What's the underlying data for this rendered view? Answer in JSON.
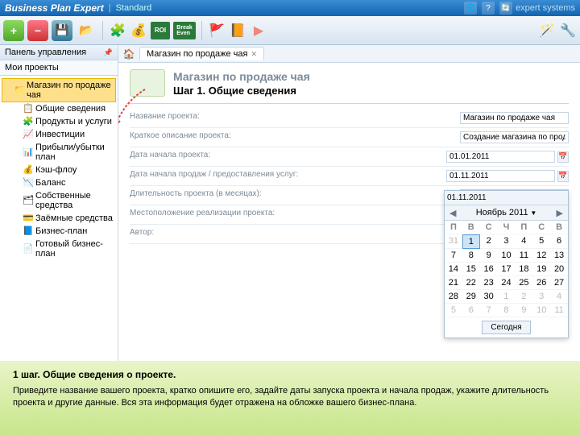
{
  "titlebar": {
    "app": "Business Plan Expert",
    "edition": "Standard",
    "brand": "expert systems"
  },
  "toolbar": {
    "items": [
      "add",
      "remove",
      "save",
      "open",
      "",
      "puzzle",
      "bag",
      "roi",
      "breakeven",
      "",
      "flag",
      "help",
      "play"
    ]
  },
  "sidebar": {
    "panel_title": "Панель управления",
    "section": "Мои проекты",
    "items": [
      {
        "icon": "📁",
        "label": "Магазин по продаже чая",
        "sel": true,
        "lvl": 1
      },
      {
        "icon": "📋",
        "label": "Общие сведения",
        "lvl": 2
      },
      {
        "icon": "🧩",
        "label": "Продукты и услуги",
        "lvl": 2
      },
      {
        "icon": "📈",
        "label": "Инвестиции",
        "lvl": 2
      },
      {
        "icon": "📊",
        "label": "Прибыли/убытки план",
        "lvl": 2
      },
      {
        "icon": "💰",
        "label": "Кэш-флоу",
        "lvl": 2
      },
      {
        "icon": "📉",
        "label": "Баланс",
        "lvl": 2
      },
      {
        "icon": "🗂",
        "label": "Собственные средства",
        "lvl": 2
      },
      {
        "icon": "💳",
        "label": "Заёмные средства",
        "lvl": 2
      },
      {
        "icon": "📘",
        "label": "Бизнес-план",
        "lvl": 2
      },
      {
        "icon": "📄",
        "label": "Готовый бизнес-план",
        "lvl": 2
      }
    ]
  },
  "tabs": {
    "active": "Магазин по продаже чая"
  },
  "page": {
    "title": "Магазин по продаже чая",
    "step": "Шаг 1. Общие сведения",
    "fields": [
      {
        "label": "Название проекта:",
        "value": "Магазин по продаже чая"
      },
      {
        "label": "Краткое описание проекта:",
        "value": "Создание магазина по продаже элитных сортов чая и кофе"
      },
      {
        "label": "Дата начала проекта:",
        "value": "01.01.2011",
        "date": true
      },
      {
        "label": "Дата начала продаж / предоставления услуг:",
        "value": "01.11.2011",
        "date": true,
        "open": true
      },
      {
        "label": "Длительность проекта (в месяцах):",
        "value": ""
      },
      {
        "label": "Местоположение реализации проекта:",
        "value": ""
      },
      {
        "label": "Автор:",
        "value": ""
      }
    ]
  },
  "calendar": {
    "selected": "01.11.2011",
    "month": "Ноябрь 2011",
    "dow": [
      "П",
      "В",
      "С",
      "Ч",
      "П",
      "С",
      "В"
    ],
    "grid": [
      [
        31,
        1,
        2,
        3,
        4,
        5,
        6
      ],
      [
        7,
        8,
        9,
        10,
        11,
        12,
        13
      ],
      [
        14,
        15,
        16,
        17,
        18,
        19,
        20
      ],
      [
        21,
        22,
        23,
        24,
        25,
        26,
        27
      ],
      [
        28,
        29,
        30,
        1,
        2,
        3,
        4
      ],
      [
        5,
        6,
        7,
        8,
        9,
        10,
        11
      ]
    ],
    "today_btn": "Сегодня"
  },
  "footer": {
    "title": "1 шаг. Общие сведения о проекте.",
    "text": "Приведите название вашего проекта, кратко опишите его, задайте даты запуска проекта и начала продаж, укажите длительность проекта и другие данные. Вся эта информация будет отражена на обложке вашего бизнес-плана."
  }
}
